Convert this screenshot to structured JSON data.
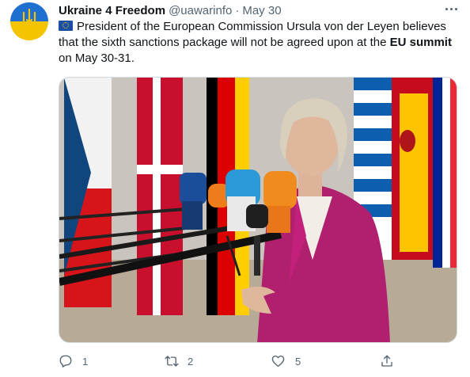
{
  "tweet": {
    "display_name": "Ukraine 4 Freedom",
    "handle": "@uawarinfo",
    "separator": "·",
    "date": "May 30",
    "text_part1": "President of the European Commission Ursula von der Leyen believes that the sixth sanctions package will not be agreed upon at the ",
    "text_bold": "EU summit",
    "text_part2": " on May 30-31.",
    "flag_emoji": "eu-flag-icon"
  },
  "actions": {
    "reply_count": "1",
    "retweet_count": "2",
    "like_count": "5"
  },
  "colors": {
    "text": "#0f1419",
    "secondary": "#536471",
    "border": "#cfd9de",
    "avatar_blue": "#1f6fd1",
    "avatar_yellow": "#f5c400"
  }
}
